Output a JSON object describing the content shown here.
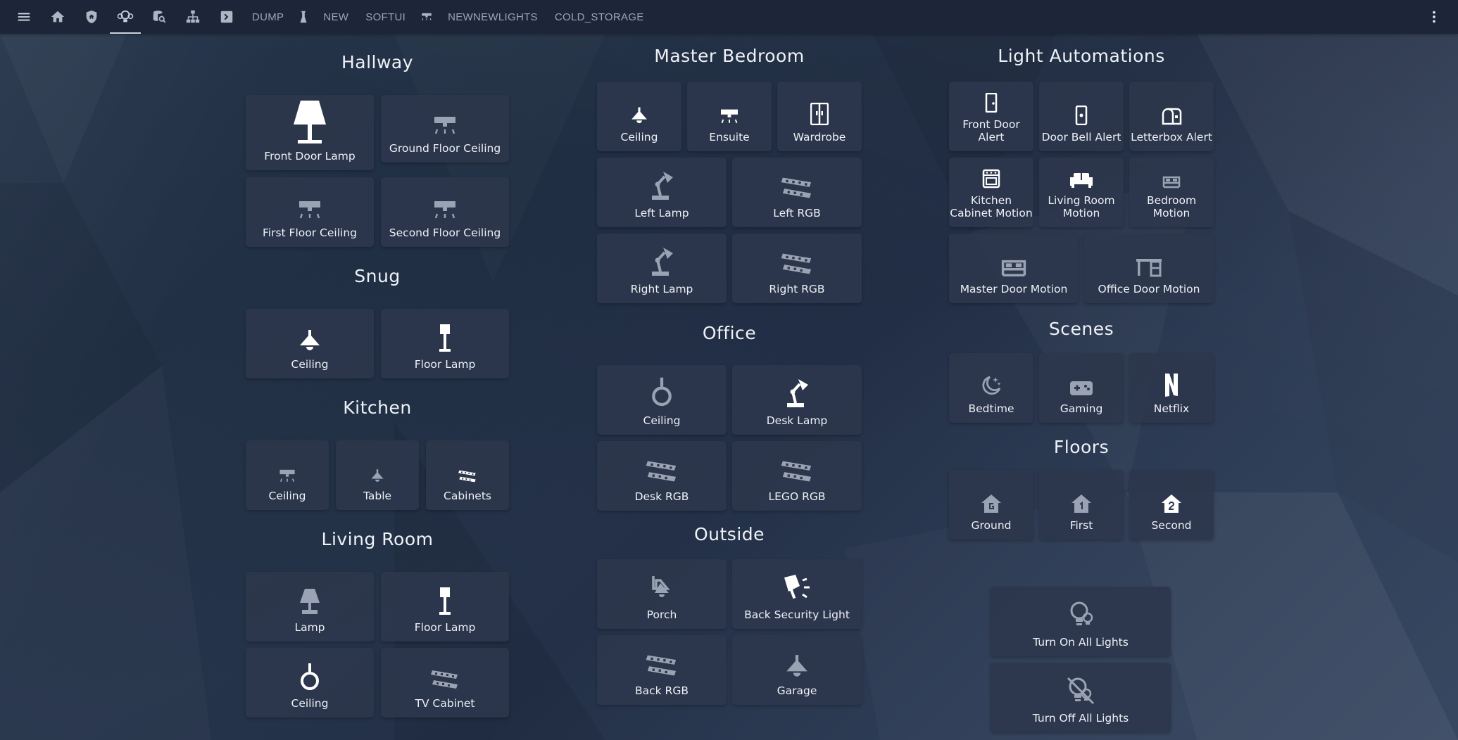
{
  "toolbar": {
    "tabs_text": [
      "DUMP",
      "NEW",
      "SOFTUI",
      "NEWNEWLIGHTS",
      "COLD_STORAGE"
    ],
    "icons": [
      "menu-icon",
      "home-icon",
      "shield-home-icon",
      "lightbulb-group-icon",
      "database-search-icon",
      "lan-icon",
      "console-icon",
      "flask-icon",
      "ceiling-light-icon",
      "more-vertical-icon"
    ]
  },
  "sections": {
    "hallway": {
      "title": "Hallway",
      "cards": [
        "Front Door Lamp",
        "Ground Floor Ceiling",
        "First Floor Ceiling",
        "Second Floor Ceiling"
      ]
    },
    "snug": {
      "title": "Snug",
      "cards": [
        "Ceiling",
        "Floor Lamp"
      ]
    },
    "kitchen": {
      "title": "Kitchen",
      "cards": [
        "Ceiling",
        "Table",
        "Cabinets"
      ]
    },
    "living_room": {
      "title": "Living Room",
      "cards": [
        "Lamp",
        "Floor Lamp",
        "Ceiling",
        "TV Cabinet"
      ]
    },
    "master_bedroom": {
      "title": "Master Bedroom",
      "cards": [
        "Ceiling",
        "Ensuite",
        "Wardrobe",
        "Left Lamp",
        "Left RGB",
        "Right Lamp",
        "Right RGB"
      ]
    },
    "office": {
      "title": "Office",
      "cards": [
        "Ceiling",
        "Desk Lamp",
        "Desk RGB",
        "LEGO RGB"
      ]
    },
    "outside": {
      "title": "Outside",
      "cards": [
        "Porch",
        "Back Security Light",
        "Back RGB",
        "Garage"
      ]
    },
    "light_automations": {
      "title": "Light Automations",
      "cards": [
        "Front Door Alert",
        "Door Bell Alert",
        "Letterbox Alert",
        "Kitchen Cabinet Motion",
        "Living Room Motion",
        "Bedroom Motion",
        "Master Door Motion",
        "Office Door Motion"
      ]
    },
    "scenes": {
      "title": "Scenes",
      "cards": [
        "Bedtime",
        "Gaming",
        "Netflix"
      ]
    },
    "floors": {
      "title": "Floors",
      "cards": [
        "Ground",
        "First",
        "Second"
      ]
    },
    "all_lights": {
      "cards": [
        "Turn On All Lights",
        "Turn Off All Lights"
      ]
    }
  },
  "colors": {
    "card_bg": "#2c364c",
    "topbar_bg": "#1d2638",
    "icon_on": "#ffffff",
    "icon_off": "#9aa3b3"
  }
}
